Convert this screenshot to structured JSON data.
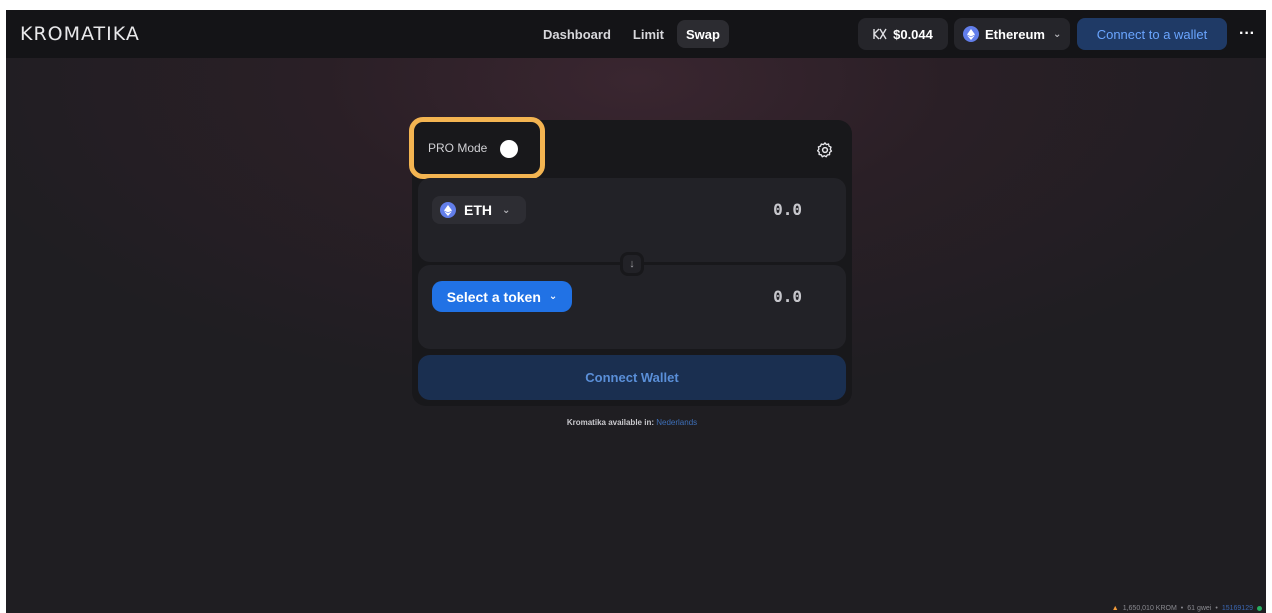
{
  "header": {
    "logo_text": "KROMATIKA",
    "nav": [
      {
        "label": "Dashboard",
        "active": false
      },
      {
        "label": "Limit",
        "active": false
      },
      {
        "label": "Swap",
        "active": true
      }
    ],
    "krom_price": "$0.044",
    "network": "Ethereum",
    "connect_label": "Connect to a wallet",
    "more_label": "···"
  },
  "swap": {
    "pro_mode_label": "PRO Mode",
    "input_token": "ETH",
    "input_amount": "0.0",
    "output_token_label": "Select a token",
    "output_amount": "0.0",
    "connect_wallet_label": "Connect Wallet",
    "available_prefix": "Kromatika available in:",
    "available_language": "Nederlands"
  },
  "status_bar": {
    "supply": "1,650,010 KROM",
    "gas": "61 gwei",
    "block": "15169129",
    "separator": "•"
  },
  "colors": {
    "accent_blue": "#2172e5",
    "highlight_orange": "#f3b451",
    "background_dark": "#1f1e22"
  },
  "icons": {
    "logo": "kromatika-logo-icon",
    "price": "krom-token-icon",
    "network": "ethereum-icon",
    "settings": "gear-icon",
    "swap_direction": "arrow-down-icon"
  }
}
